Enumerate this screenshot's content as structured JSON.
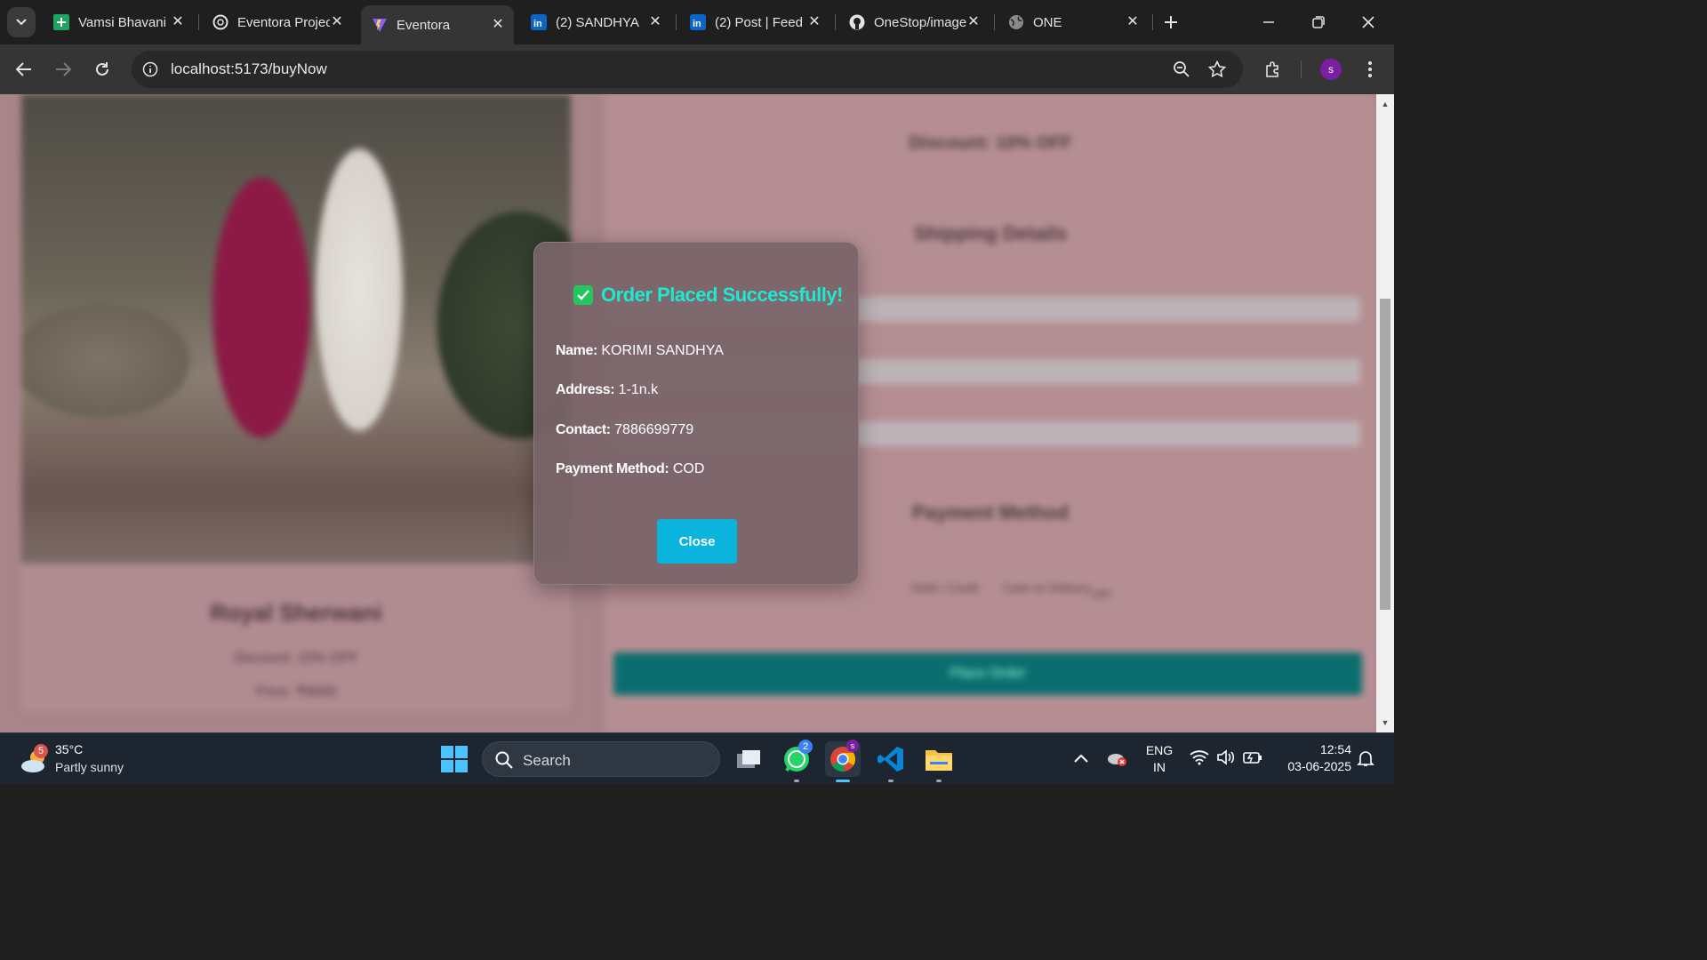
{
  "browser": {
    "tabs": [
      {
        "title": "Vamsi Bhavani",
        "icon": "sheets-icon"
      },
      {
        "title": "Eventora Project",
        "icon": "chatgpt-icon"
      },
      {
        "title": "Eventora",
        "icon": "vite-icon",
        "active": true
      },
      {
        "title": "(2) SANDHYA",
        "icon": "linkedin-icon"
      },
      {
        "title": "(2) Post | Feed",
        "icon": "linkedin-icon"
      },
      {
        "title": "OneStop/images",
        "icon": "github-icon"
      },
      {
        "title": "ONE",
        "icon": "globe-icon"
      }
    ],
    "url": "localhost:5173/buyNow",
    "profile_initial": "s"
  },
  "page": {
    "product_name": "Royal Sherwani",
    "discount_line": "Discount: 10% OFF",
    "price_line": "Price: ₹8000",
    "right_discount_line": "Discount: 10% OFF",
    "shipping_heading": "Shipping Details",
    "name_placeholder": "KORIMI SANDHYA",
    "address_placeholder": "1-1n.k",
    "payment_heading": "Payment Method",
    "payment_options": [
      "Debit / Credit",
      "Cash on Delivery",
      "UPI"
    ],
    "place_order_label": "Place Order"
  },
  "modal": {
    "title": "Order Placed Successfully!",
    "name_label": "Name:",
    "name_value": "KORIMI SANDHYA",
    "address_label": "Address:",
    "address_value": "1-1n.k",
    "contact_label": "Contact:",
    "contact_value": "7886699779",
    "payment_label": "Payment Method:",
    "payment_value": "COD",
    "close_label": "Close"
  },
  "taskbar": {
    "weather_temp": "35°C",
    "weather_cond": "Partly sunny",
    "weather_badge": "5",
    "search_label": "Search",
    "whatsapp_badge": "2",
    "lang_top": "ENG",
    "lang_bottom": "IN",
    "time": "12:54",
    "date": "03-06-2025"
  },
  "colors": {
    "success_green": "#22c55e",
    "success_text": "#1de9d0",
    "close_button": "#0ab4dc",
    "place_order": "#0b6e6e"
  }
}
